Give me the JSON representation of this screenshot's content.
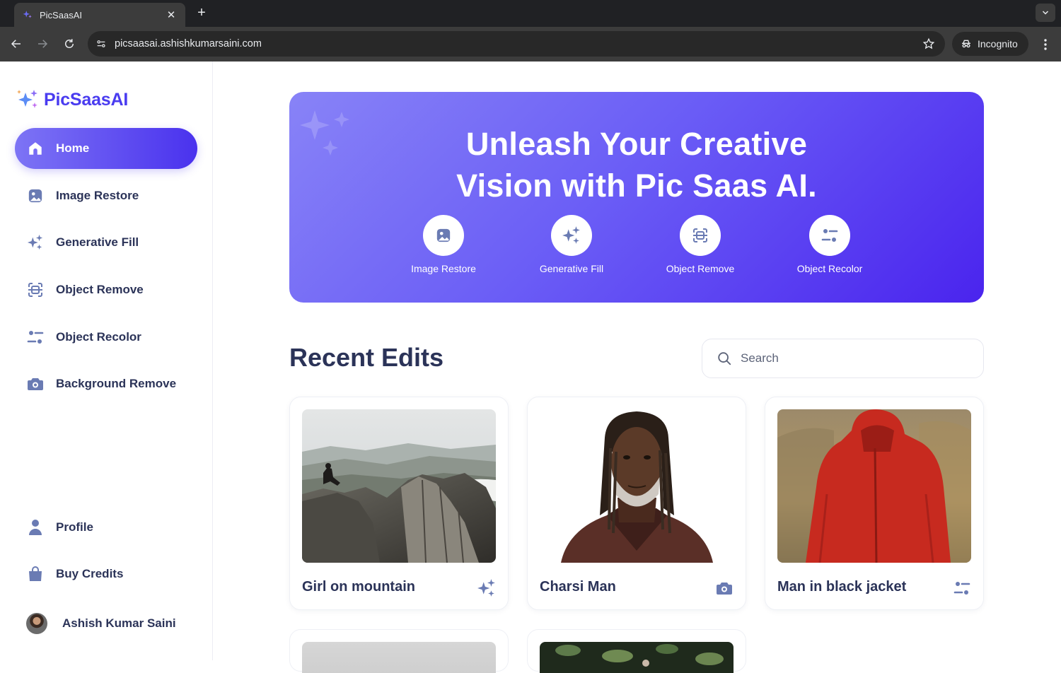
{
  "browser": {
    "tab_title": "PicSaasAI",
    "url": "picsaasai.ashishkumarsaini.com",
    "incognito_label": "Incognito"
  },
  "app": {
    "logo_text": "PicSaasAI"
  },
  "sidebar": {
    "items": [
      {
        "label": "Home",
        "icon": "home-icon",
        "active": true
      },
      {
        "label": "Image Restore",
        "icon": "image-icon"
      },
      {
        "label": "Generative Fill",
        "icon": "sparkles-icon"
      },
      {
        "label": "Object Remove",
        "icon": "scan-icon"
      },
      {
        "label": "Object Recolor",
        "icon": "filter-icon"
      },
      {
        "label": "Background Remove",
        "icon": "camera-icon"
      }
    ],
    "bottom_items": [
      {
        "label": "Profile",
        "icon": "user-icon"
      },
      {
        "label": "Buy Credits",
        "icon": "bag-icon"
      }
    ],
    "user_name": "Ashish Kumar Saini"
  },
  "hero": {
    "title_line1": "Unleash Your Creative",
    "title_line2": "Vision with Pic Saas AI.",
    "features": [
      {
        "label": "Image Restore",
        "icon": "image-icon"
      },
      {
        "label": "Generative Fill",
        "icon": "sparkles-icon"
      },
      {
        "label": "Object Remove",
        "icon": "scan-icon"
      },
      {
        "label": "Object Recolor",
        "icon": "filter-icon"
      }
    ]
  },
  "recent": {
    "title": "Recent Edits",
    "search_placeholder": "Search",
    "cards": [
      {
        "title": "Girl on mountain",
        "icon": "sparkles-icon"
      },
      {
        "title": "Charsi Man",
        "icon": "camera-icon"
      },
      {
        "title": "Man in black jacket",
        "icon": "filter-icon"
      }
    ]
  },
  "colors": {
    "accent": "#4a32ee",
    "text_dark": "#2b3358",
    "hero_gradient_start": "#8883f7",
    "hero_gradient_end": "#4a24ee"
  }
}
